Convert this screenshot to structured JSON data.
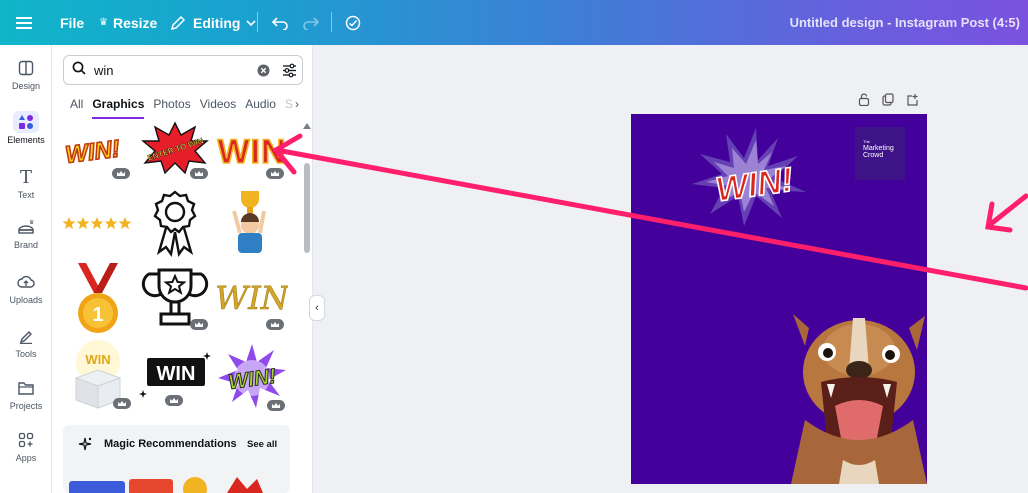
{
  "topbar": {
    "menu_icon": "hamburger-icon",
    "file_label": "File",
    "resize_label": "Resize",
    "editing_label": "Editing",
    "doc_title": "Untitled design - Instagram Post (4:5)"
  },
  "rail": {
    "items": [
      {
        "label": "Design",
        "icon": "layout-icon"
      },
      {
        "label": "Elements",
        "icon": "shapes-icon"
      },
      {
        "label": "Text",
        "icon": "text-icon"
      },
      {
        "label": "Brand",
        "icon": "brand-icon"
      },
      {
        "label": "Uploads",
        "icon": "cloud-upload-icon"
      },
      {
        "label": "Tools",
        "icon": "pen-icon"
      },
      {
        "label": "Projects",
        "icon": "folder-icon"
      },
      {
        "label": "Apps",
        "icon": "apps-icon"
      }
    ]
  },
  "panel": {
    "search": {
      "value": "win",
      "placeholder": ""
    },
    "tabs": [
      "All",
      "Graphics",
      "Photos",
      "Videos",
      "Audio",
      "S"
    ],
    "active_tab": "Graphics",
    "magic": {
      "title": "Magic Recommendations",
      "see_all": "See all"
    }
  },
  "graphics": [
    {
      "name": "graphic-win-yellow",
      "text": "WIN!",
      "premium": true
    },
    {
      "name": "graphic-enter-to-win",
      "text": "ENTER TO WIN",
      "premium": true
    },
    {
      "name": "graphic-win-marquee",
      "text": "WIN",
      "premium": true
    },
    {
      "name": "graphic-five-stars",
      "text": "",
      "premium": false
    },
    {
      "name": "graphic-award-ribbon",
      "text": "",
      "premium": false
    },
    {
      "name": "graphic-trophy-kid",
      "text": "",
      "premium": false
    },
    {
      "name": "graphic-gold-medal",
      "text": "1",
      "premium": false
    },
    {
      "name": "graphic-trophy-outline",
      "text": "",
      "premium": true
    },
    {
      "name": "graphic-win-gold-script",
      "text": "WIN",
      "premium": true
    },
    {
      "name": "graphic-win-gift-box",
      "text": "WIN",
      "premium": true
    },
    {
      "name": "graphic-win-black-banner",
      "text": "WIN",
      "premium": true
    },
    {
      "name": "graphic-win-comic-green",
      "text": "WIN!",
      "premium": true
    }
  ],
  "canvas": {
    "background_color": "#44009a",
    "sticker_text": "WIN!",
    "logo_small": "The",
    "logo_text": "Marketing Crowd"
  },
  "annotation_color": "#ff1f6a"
}
